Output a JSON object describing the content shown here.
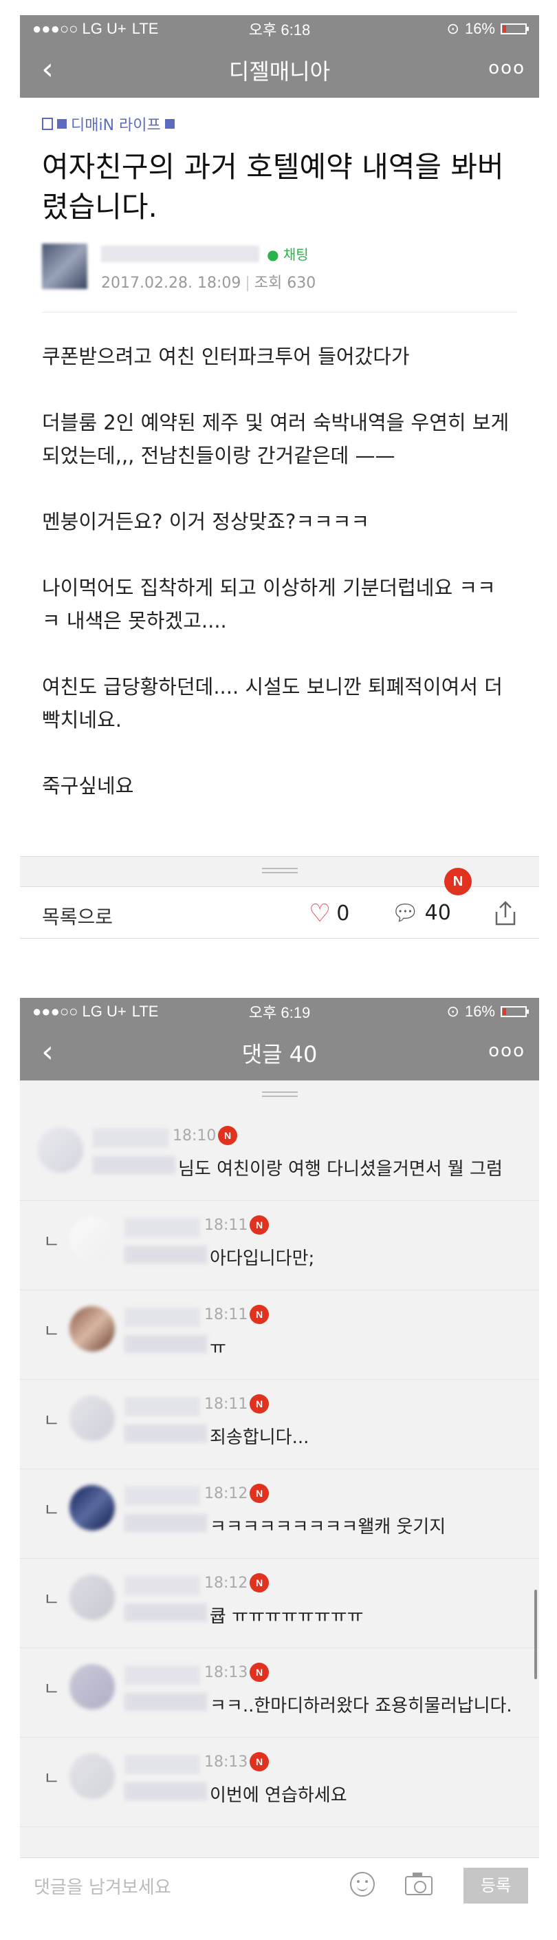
{
  "top_screen": {
    "status": {
      "carrier": "●●●○○ LG U+",
      "network": "LTE",
      "time": "오후 6:18",
      "battery": "16%",
      "battery_level": 0.16
    },
    "nav": {
      "back_icon": "chevron-left-icon",
      "title": "디젤매니아",
      "more": "ooo"
    },
    "breadcrumb": "디매iN 라이프",
    "title": "여자친구의 과거 호텔예약 내역을 봐버렸습니다.",
    "chat_label": "채팅",
    "date": "2017.02.28. 18:09",
    "views": "조회 630",
    "body": [
      "쿠폰받으려고 여친 인터파크투어 들어갔다가",
      "더블룸 2인 예약된 제주 및 여러 숙박내역을 우연히 보게되었는데,,, 전남친들이랑 간거같은데 ——",
      "멘붕이거든요? 이거 정상맞죠?ㅋㅋㅋㅋ",
      "나이먹어도 집착하게 되고 이상하게 기분더럽네요 ㅋㅋㅋ 내색은 못하겠고....",
      "여친도 급당황하던데.... 시설도 보니깐 퇴폐적이여서 더 빡치네요.",
      "죽구싶네요"
    ],
    "actions": {
      "list": "목록으로",
      "likes": "0",
      "comments": "40",
      "new_badge": "N"
    }
  },
  "bottom_screen": {
    "status": {
      "carrier": "●●●○○ LG U+",
      "network": "LTE",
      "time": "오후 6:19",
      "battery": "16%",
      "battery_level": 0.16
    },
    "nav": {
      "back_icon": "chevron-left-icon",
      "title": "댓글 40",
      "more": "ooo"
    },
    "comments": [
      {
        "time": "18:10",
        "badge": "N",
        "text": "님도 여친이랑 여행 다니셨을거면서 뭘 그럼",
        "reply": ""
      },
      {
        "time": "18:11",
        "badge": "N",
        "text": "아다입니다만;",
        "reply": "ㄴ"
      },
      {
        "time": "18:11",
        "badge": "N",
        "text": "ㅠ",
        "reply": "ㄴ"
      },
      {
        "time": "18:11",
        "badge": "N",
        "text": "죄송합니다...",
        "reply": "ㄴ"
      },
      {
        "time": "18:12",
        "badge": "N",
        "text": "ㅋㅋㅋㅋㅋㅋㅋㅋㅋ왤캐 웃기지",
        "reply": "ㄴ"
      },
      {
        "time": "18:12",
        "badge": "N",
        "text": "큡 ㅠㅠㅠㅠㅠㅠㅠㅠ",
        "reply": "ㄴ"
      },
      {
        "time": "18:13",
        "badge": "N",
        "text": "ㅋㅋ..한마디하러왔다 죠용히물러납니다.",
        "reply": "ㄴ"
      },
      {
        "time": "18:13",
        "badge": "N",
        "text": "이번에 연습하세요",
        "reply": "ㄴ"
      }
    ],
    "input": {
      "placeholder": "댓글을 남겨보세요",
      "submit": "등록"
    }
  }
}
